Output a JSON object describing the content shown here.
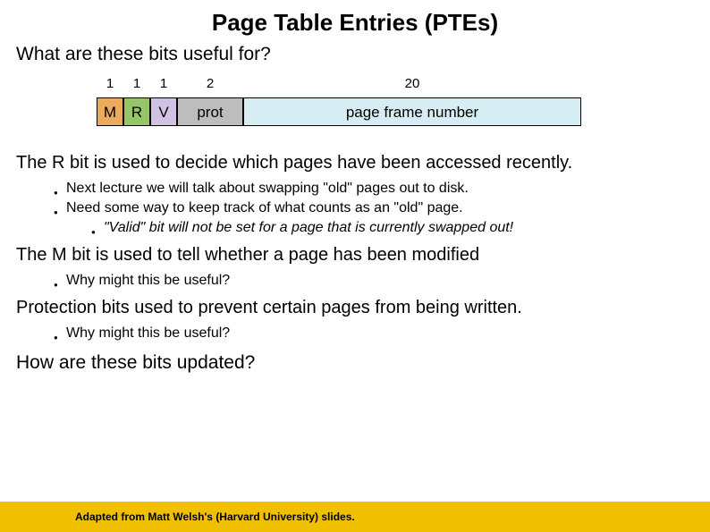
{
  "title": "Page Table Entries (PTEs)",
  "subtitle": "What are these bits useful for?",
  "pte": {
    "widths": [
      "1",
      "1",
      "1",
      "2",
      "20"
    ],
    "cells": [
      "M",
      "R",
      "V",
      "prot",
      "page frame number"
    ]
  },
  "sections": [
    {
      "text": "The R bit is used to decide which pages have been accessed recently.",
      "bullets": [
        {
          "text": "Next lecture we will talk about swapping \"old\" pages out to disk."
        },
        {
          "text": "Need some way to keep track of what counts as an \"old\" page.",
          "sub": [
            "\"Valid\" bit will not be set for a page that is currently swapped out!"
          ]
        }
      ]
    },
    {
      "text": "The M bit is used to tell whether a page has been modified",
      "bullets": [
        {
          "text": "Why might this be useful?"
        }
      ]
    },
    {
      "text": "Protection bits used to prevent certain pages from being written.",
      "bullets": [
        {
          "text": "Why might this be useful?"
        }
      ]
    }
  ],
  "question": "How are these bits updated?",
  "attribution": "Adapted from Matt Welsh's (Harvard University) slides."
}
